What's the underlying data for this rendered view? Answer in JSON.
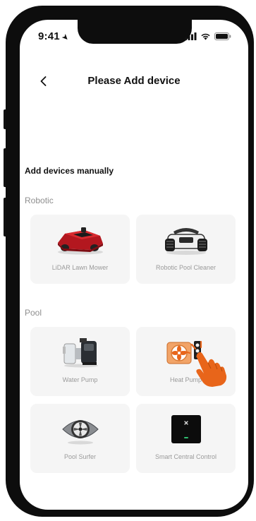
{
  "status_bar": {
    "time": "9:41"
  },
  "nav": {
    "title": "Please Add device"
  },
  "section_heading": "Add devices manually",
  "categories": [
    {
      "label": "Robotic",
      "devices": [
        {
          "label": "LiDAR Lawn Mower",
          "icon": "lawn-mower-icon"
        },
        {
          "label": "Robotic Pool Cleaner",
          "icon": "pool-cleaner-icon"
        }
      ]
    },
    {
      "label": "Pool",
      "devices": [
        {
          "label": "Water Pump",
          "icon": "water-pump-icon"
        },
        {
          "label": "Heat Pump",
          "icon": "heat-pump-icon"
        },
        {
          "label": "Pool Surfer",
          "icon": "pool-surfer-icon"
        },
        {
          "label": "Smart Central Control",
          "icon": "central-control-icon"
        }
      ]
    }
  ],
  "colors": {
    "accent": "#e8651a",
    "mower_red": "#b3171f",
    "card_bg": "#f5f5f5"
  }
}
